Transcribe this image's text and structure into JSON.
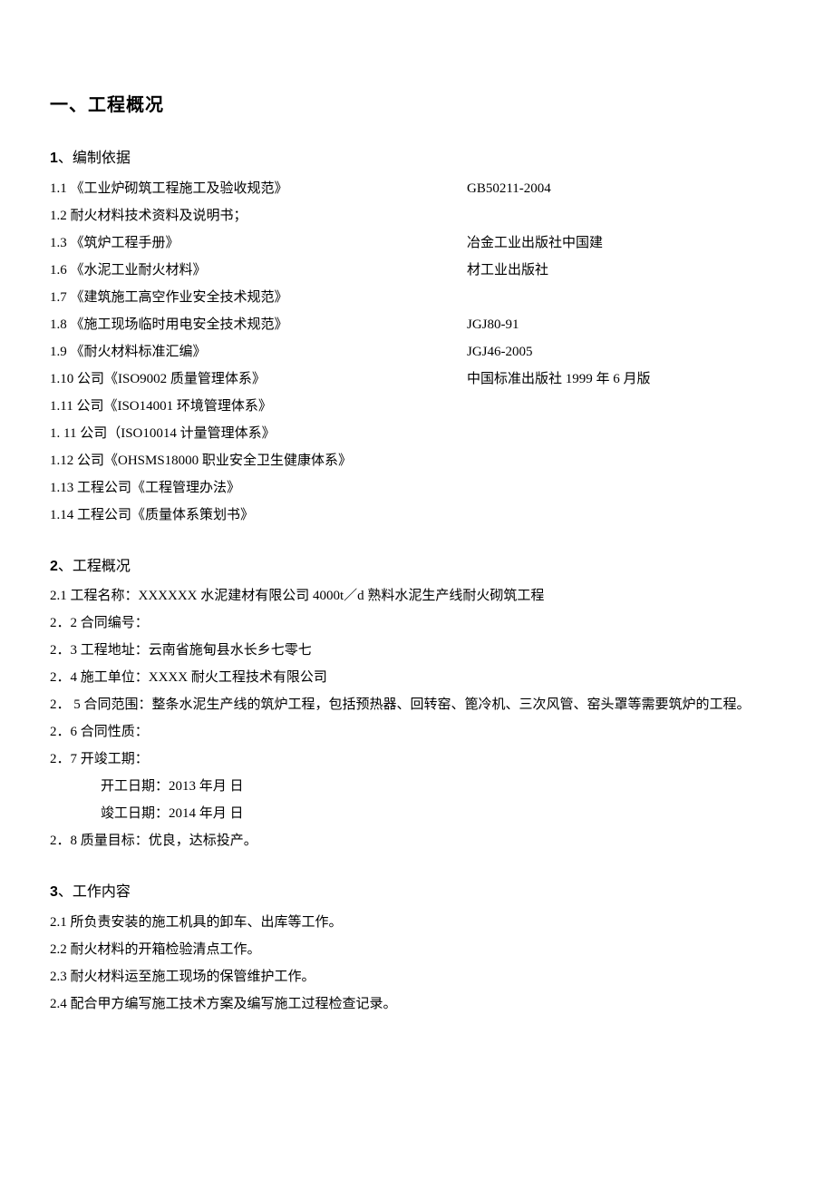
{
  "title": "一、工程概况",
  "section1": {
    "heading_num": "1",
    "heading": "、编制依据",
    "items": [
      {
        "num": "1.1",
        "left": "《工业炉砌筑工程施工及验收规范》",
        "right": "GB50211-2004"
      },
      {
        "num": "1.2",
        "left": "耐火材料技术资料及说明书；",
        "right": ""
      },
      {
        "num": "1.3",
        "left": "《筑炉工程手册》",
        "right": "冶金工业出版社中国建"
      },
      {
        "num": "1.6",
        "left": "《水泥工业耐火材料》",
        "right": "材工业出版社"
      },
      {
        "num": "1.7",
        "left": "《建筑施工高空作业安全技术规范》",
        "right": ""
      },
      {
        "num": "1.8",
        "left": "《施工现场临时用电安全技术规范》",
        "right": "JGJ80-91"
      },
      {
        "num": "1.9",
        "left": "《耐火材料标准汇编》",
        "right": "JGJ46-2005"
      },
      {
        "num": "1.10",
        "left": "公司《ISO9002 质量管理体系》",
        "right": "中国标准出版社 1999 年 6 月版"
      },
      {
        "num": "1.11",
        "left": " 公司《ISO14001 环境管理体系》",
        "right": ""
      },
      {
        "num": "1. 11",
        "left": "公司（ISO10014 计量管理体系》",
        "right": ""
      },
      {
        "num": "1.12",
        "left": "公司《OHSMS18000 职业安全卫生健康体系》",
        "right": ""
      },
      {
        "num": "1.13",
        "left": " 工程公司《工程管理办法》",
        "right": ""
      },
      {
        "num": "1.14",
        "left": " 工程公司《质量体系策划书》",
        "right": ""
      }
    ]
  },
  "section2": {
    "heading_num": "2",
    "heading": "、工程概况",
    "items": [
      "2.1 工程名称：XXXXXX 水泥建材有限公司 4000t／d 熟料水泥生产线耐火砌筑工程",
      "2．2 合同编号：",
      "2．3 工程地址：云南省施甸县水长乡七零七",
      "2．4 施工单位：XXXX 耐火工程技术有限公司",
      "2． 5 合同范围：整条水泥生产线的筑炉工程，包括预热器、回转窑、篦冷机、三次风管、窑头罩等需要筑炉的工程。",
      "2．6 合同性质：",
      "2．7 开竣工期："
    ],
    "dates": [
      "开工日期：2013 年月        日",
      "竣工日期：2014 年月        日"
    ],
    "item28": "2．8 质量目标：优良，达标投产。"
  },
  "section3": {
    "heading_num": "3",
    "heading": "、工作内容",
    "items": [
      "2.1  所负责安装的施工机具的卸车、出库等工作。",
      "2.2  耐火材料的开箱检验清点工作。",
      "2.3  耐火材料运至施工现场的保管维护工作。",
      "2.4  配合甲方编写施工技术方案及编写施工过程检查记录。"
    ]
  }
}
